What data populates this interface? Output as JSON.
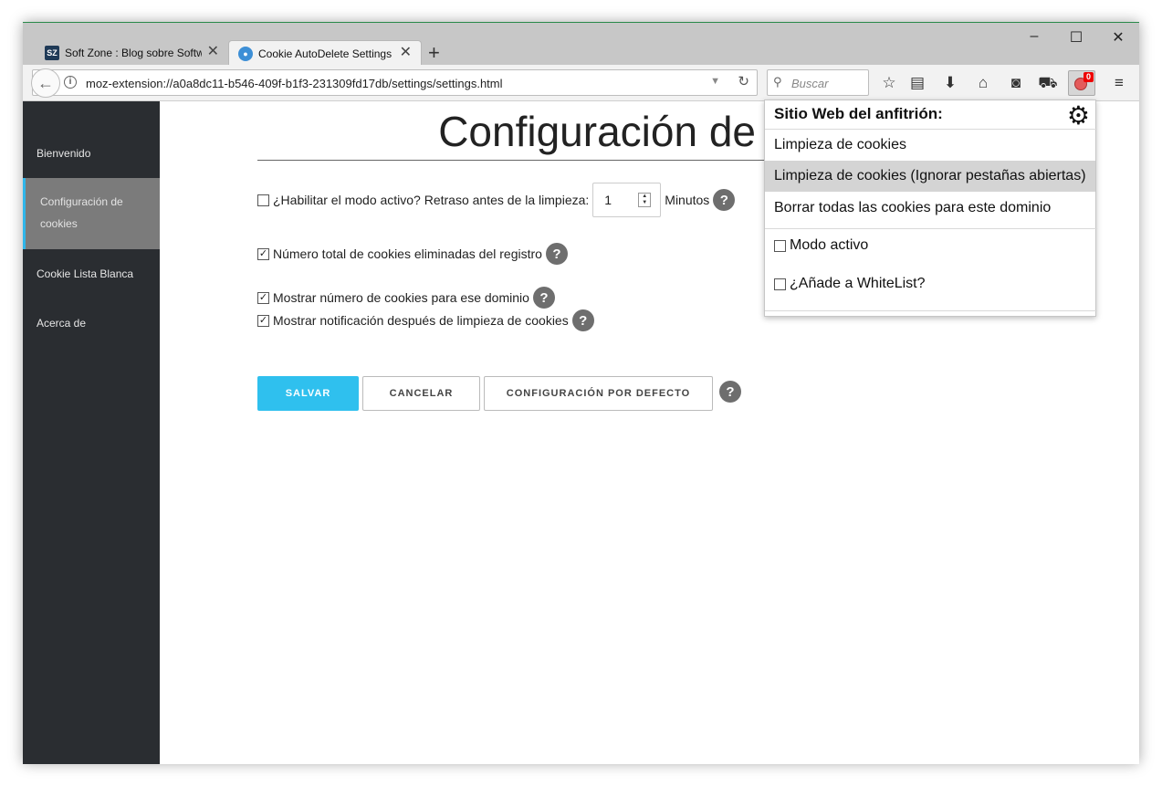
{
  "browser": {
    "tabs": [
      {
        "label": "Soft Zone : Blog sobre Softw",
        "icon": "softzone-favicon",
        "icon_text": "SZ"
      },
      {
        "label": "Cookie AutoDelete Settings",
        "icon": "cookie-autodelete-favicon"
      }
    ],
    "url": "moz-extension://a0a8dc11-b546-409f-b1f3-231309fd17db/settings/settings.html",
    "search_placeholder": "Buscar",
    "extension_badge": "0"
  },
  "sidebar": {
    "items": [
      {
        "label": "Bienvenido"
      },
      {
        "label": "Configuración de cookies",
        "active": true
      },
      {
        "label": "Cookie Lista Blanca"
      },
      {
        "label": "Acerca de"
      }
    ]
  },
  "main": {
    "title": "Configuración de c",
    "active_mode": {
      "label": "¿Habilitar el modo activo? Retraso antes de la limpieza:",
      "checked": false,
      "delay_value": "1",
      "unit": "Minutos"
    },
    "options": [
      {
        "label": "Número total de cookies eliminadas del registro",
        "checked": true
      },
      {
        "label": "Mostrar número de cookies para ese dominio",
        "checked": true
      },
      {
        "label": "Mostrar notificación después de limpieza de cookies",
        "checked": true
      }
    ],
    "buttons": {
      "save": "SALVAR",
      "cancel": "CANCELAR",
      "default": "CONFIGURACIÓN POR DEFECTO"
    },
    "help_glyph": "?"
  },
  "popup": {
    "heading": "Sitio Web del anfitrión:",
    "actions": [
      {
        "label": "Limpieza de cookies"
      },
      {
        "label": "Limpieza de cookies (Ignorar pestañas abiertas)",
        "highlighted": true
      },
      {
        "label": "Borrar todas las cookies para este dominio"
      }
    ],
    "toggles": [
      {
        "label": "Modo activo",
        "checked": false
      },
      {
        "label": "¿Añade a WhiteList?",
        "checked": false
      }
    ]
  },
  "colors": {
    "accent": "#2fc0ee",
    "sidebar_bg": "#2a2d31",
    "sidebar_active": "#7b7b7b",
    "help_bg": "#6e6e6e",
    "badge": "#ee0000"
  }
}
